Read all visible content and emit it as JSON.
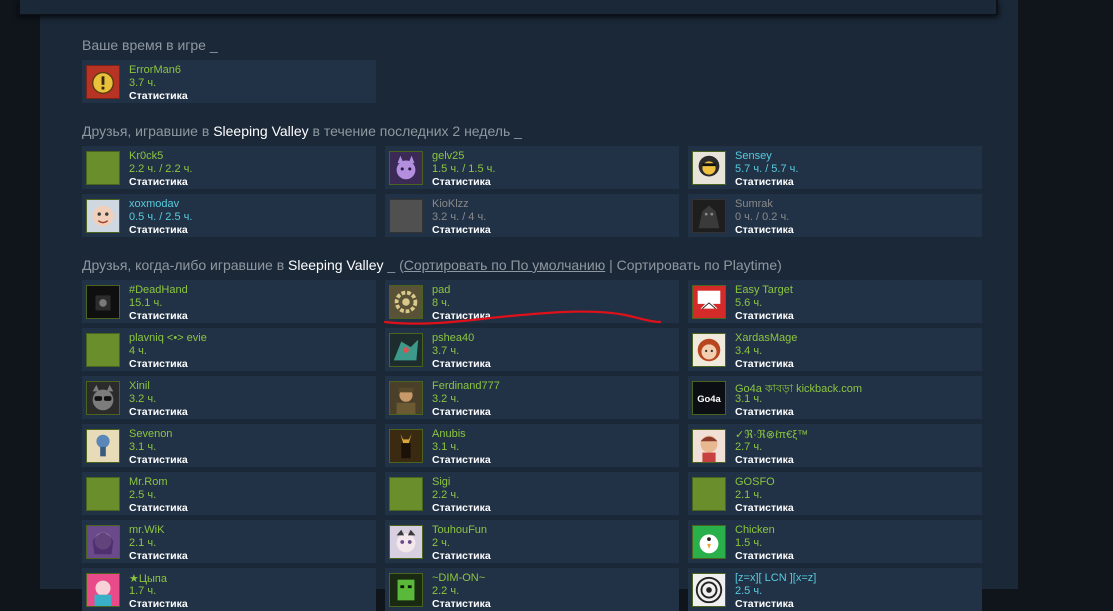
{
  "my_time": {
    "title": "Ваше время в игре _",
    "card": {
      "name": "ErrorMan6",
      "hours": "3.7 ч.",
      "stats": "Статистика"
    }
  },
  "recent": {
    "title_pre": "Друзья, игравшие в ",
    "game": "Sleeping Valley",
    "title_post": " в течение последних 2 недель _",
    "friends": [
      {
        "name": "Kr0ck5",
        "hours": "2.2 ч. / 2.2 ч.",
        "stats": "Статистика",
        "avatar": "default-avatar",
        "status": "ingame"
      },
      {
        "name": "gelv25",
        "hours": "1.5 ч. / 1.5 ч.",
        "stats": "Статистика",
        "avatar": "purple-cat-avatar",
        "status": "ingame"
      },
      {
        "name": "Sensey",
        "hours": "5.7 ч. / 5.7 ч.",
        "stats": "Статистика",
        "avatar": "lion-avatar",
        "status": "online"
      },
      {
        "name": "xoxmodav",
        "hours": "0.5 ч. / 2.5 ч.",
        "stats": "Статистика",
        "avatar": "baby-avatar",
        "status": "online"
      },
      {
        "name": "KioKlzz",
        "hours": "3.2 ч. / 4 ч.",
        "stats": "Статистика",
        "avatar": "grey-avatar",
        "status": "offline"
      },
      {
        "name": "Sumrak",
        "hours": "0 ч. / 0.2 ч.",
        "stats": "Статистика",
        "avatar": "dark-creature-avatar",
        "status": "offline"
      }
    ]
  },
  "ever": {
    "title_pre": "Друзья, когда-либо игравшие в ",
    "game": "Sleeping Valley",
    "title_mid": " _ (",
    "sort_default": "Сортировать по По умолчанию",
    "separator": " | ",
    "sort_playtime": "Сортировать по Playtime",
    "title_end": ")",
    "friends": [
      {
        "name": "#DeadHand",
        "hours": "15.1 ч.",
        "stats": "Статистика",
        "avatar": "dark-hand-avatar",
        "status": "ingame"
      },
      {
        "name": "pad",
        "hours": "8 ч.",
        "stats": "Статистика",
        "avatar": "gear-avatar",
        "status": "ingame"
      },
      {
        "name": "Easy Target",
        "hours": "5.6 ч.",
        "stats": "Статистика",
        "avatar": "red-comic-avatar",
        "status": "ingame"
      },
      {
        "name": "plavniq <•> evie",
        "hours": "4 ч.",
        "stats": "Статистика",
        "avatar": "default-avatar",
        "status": "ingame"
      },
      {
        "name": "pshea40",
        "hours": "3.7 ч.",
        "stats": "Статистика",
        "avatar": "robot-avatar",
        "status": "ingame"
      },
      {
        "name": "XardasMage",
        "hours": "3.4 ч.",
        "stats": "Статистика",
        "avatar": "redhead-avatar",
        "status": "ingame"
      },
      {
        "name": "Xinil",
        "hours": "3.2 ч.",
        "stats": "Статистика",
        "avatar": "cat-sunglasses-avatar",
        "status": "ingame"
      },
      {
        "name": "Ferdinand777",
        "hours": "3.2 ч.",
        "stats": "Статистика",
        "avatar": "soldier-avatar",
        "status": "ingame"
      },
      {
        "name": "Go4a কাবড়া kickback.com",
        "hours": "3.1 ч.",
        "stats": "Статистика",
        "avatar": "go4a-logo-avatar",
        "avatar_text": "Go4a",
        "status": "ingame"
      },
      {
        "name": "Sevenon",
        "hours": "3.1 ч.",
        "stats": "Статистика",
        "avatar": "cartoon-avatar",
        "status": "ingame"
      },
      {
        "name": "Anubis",
        "hours": "3.1 ч.",
        "stats": "Статистика",
        "avatar": "anubis-avatar",
        "status": "ingame"
      },
      {
        "name": "✓ℜ·ℜ⊗ℓπ€ξ™",
        "hours": "2.7 ч.",
        "stats": "Статистика",
        "avatar": "anime-avatar",
        "status": "ingame"
      },
      {
        "name": "Mr.Rom",
        "hours": "2.5 ч.",
        "stats": "Статистика",
        "avatar": "default-avatar",
        "status": "ingame"
      },
      {
        "name": "Sigi",
        "hours": "2.2 ч.",
        "stats": "Статистика",
        "avatar": "default-avatar",
        "status": "ingame"
      },
      {
        "name": "GOSFO",
        "hours": "2.1 ч.",
        "stats": "Статистика",
        "avatar": "default-avatar",
        "status": "ingame"
      },
      {
        "name": "mr.WiK",
        "hours": "2.1 ч.",
        "stats": "Статистика",
        "avatar": "purple-anime-avatar",
        "status": "ingame"
      },
      {
        "name": "TouhouFun",
        "hours": "2 ч.",
        "stats": "Статистика",
        "avatar": "touhou-avatar",
        "status": "ingame"
      },
      {
        "name": "Chicken",
        "hours": "1.5 ч.",
        "stats": "Статистика",
        "avatar": "chicken-avatar",
        "status": "ingame"
      },
      {
        "name": "★Цыпа",
        "hours": "1.7 ч.",
        "stats": "Статистика",
        "avatar": "pink-avatar",
        "status": "ingame"
      },
      {
        "name": "~DIM-ON~",
        "hours": "2.2 ч.",
        "stats": "Статистика",
        "avatar": "green-face-avatar",
        "status": "ingame"
      },
      {
        "name": "[z=x][ LCN ][x=z]",
        "hours": "2.5 ч.",
        "stats": "Статистика",
        "avatar": "spiral-avatar",
        "status": "online"
      }
    ]
  },
  "colors": {
    "ingame": "#8bc53f",
    "online": "#57cbde",
    "offline": "#898989",
    "annotation": "#e0101a"
  }
}
